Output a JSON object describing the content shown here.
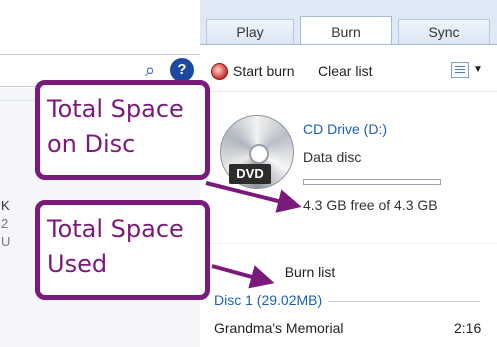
{
  "tabs": [
    {
      "label": "Play"
    },
    {
      "label": "Burn"
    },
    {
      "label": "Sync"
    }
  ],
  "toolbar": {
    "start_burn": "Start burn",
    "clear_list": "Clear list",
    "icons": [
      "search-icon",
      "help-icon",
      "burn-icon",
      "list-options-icon"
    ]
  },
  "left_pane": {
    "fragments": [
      "K",
      "2",
      "U"
    ]
  },
  "disc": {
    "drive_name": "CD Drive (D:)",
    "type": "Data disc",
    "badge": "DVD",
    "free_text": "4.3 GB free of 4.3 GB",
    "used_fraction": 0.0
  },
  "burn_list": {
    "title": "Burn list",
    "disc_label": "Disc 1 (29.02MB)",
    "tracks": [
      {
        "title": "Grandma's Memorial",
        "duration": "2:16"
      }
    ]
  },
  "callouts": {
    "space_on_disc": {
      "line1": "Total Space",
      "line2": "on Disc"
    },
    "space_used": {
      "line1": "Total Space",
      "line2": "Used"
    }
  },
  "colors": {
    "callout": "#7a1a7a",
    "link_blue": "#1c5fb8",
    "tab_strip": "#dfe9f5"
  }
}
